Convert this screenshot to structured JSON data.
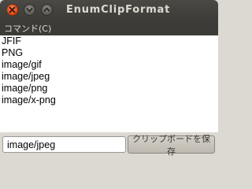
{
  "window": {
    "title": "EnumClipFormat"
  },
  "menubar": {
    "command_label": "コマンド(C)"
  },
  "formats": [
    "JFIF",
    "PNG",
    "image/gif",
    "image/jpeg",
    "image/png",
    "image/x-png"
  ],
  "format_input": {
    "value": "image/jpeg"
  },
  "save_button": {
    "label": "クリップボードを保存"
  },
  "colors": {
    "titlebar": "#3c3b37",
    "close_button": "#df4a16",
    "window_bg": "#dcd9d3"
  },
  "icons": {
    "close": "close-icon",
    "minimize": "minimize-icon",
    "maximize": "maximize-icon"
  }
}
